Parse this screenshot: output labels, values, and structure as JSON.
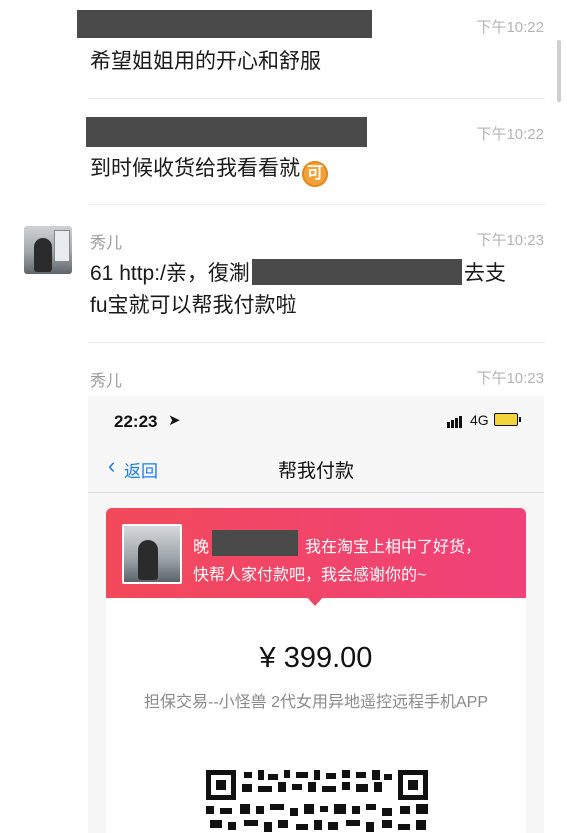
{
  "messages": [
    {
      "time": "下午10:22",
      "text": "希望姐姐用的开心和舒服"
    },
    {
      "time": "下午10:22",
      "text": "到时候收货给我看看就",
      "emoji": "可"
    },
    {
      "sender": "秀儿",
      "time": "下午10:23",
      "line1_prefix": "61 http:/亲，復淛",
      "line1_suffix": "去支",
      "line2": "fu宝就可以帮我付款啦"
    },
    {
      "sender": "秀儿",
      "time": "下午10:23"
    }
  ],
  "screenshot": {
    "status_time": "22:23",
    "network": "4G",
    "back_label": "返回",
    "title": "帮我付款",
    "greeting_prefix": "晚",
    "request_line1": "我在淘宝上相中了好货，",
    "request_line2": "快帮人家付款吧，我会感谢你的~",
    "amount": "¥ 399.00",
    "description": "担保交易--小怪兽 2代女用异地遥控远程手机APP"
  },
  "colors": {
    "accent_red": "#f2495a",
    "link_blue": "#1a7cf5",
    "redaction": "#4a4a4a"
  }
}
